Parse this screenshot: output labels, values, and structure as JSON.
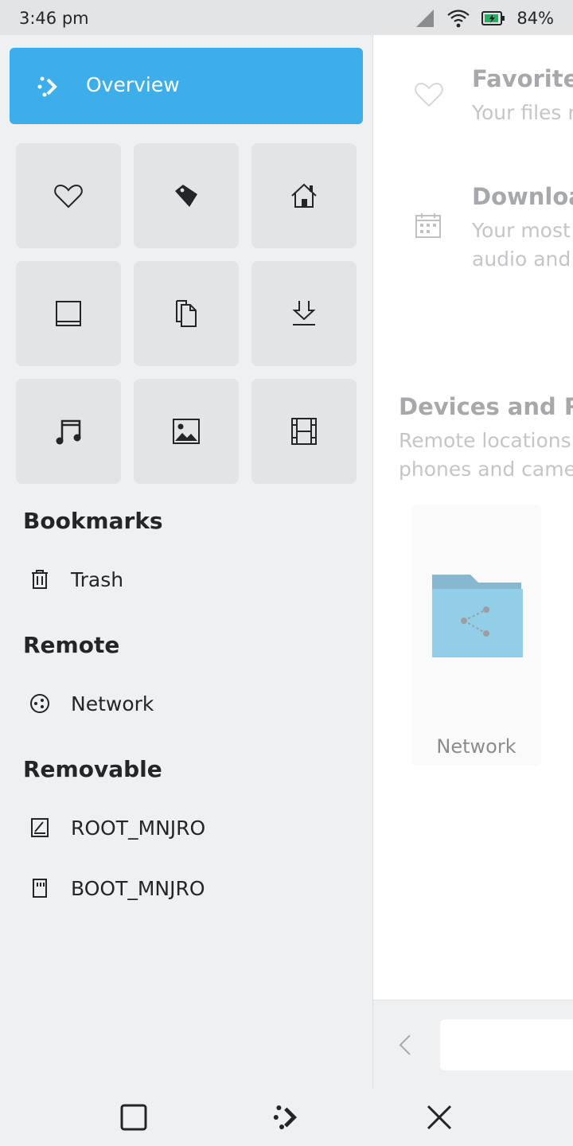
{
  "status": {
    "time": "3:46 pm",
    "battery": "84%"
  },
  "sidebar": {
    "overview_label": "Overview",
    "tiles": [
      "heart-icon",
      "tag-icon",
      "home-icon",
      "desktop-icon",
      "documents-icon",
      "download-icon",
      "music-icon",
      "pictures-icon",
      "video-icon"
    ],
    "sections": {
      "bookmarks": {
        "title": "Bookmarks",
        "items": [
          {
            "label": "Trash",
            "icon": "trash-icon"
          }
        ]
      },
      "remote": {
        "title": "Remote",
        "items": [
          {
            "label": "Network",
            "icon": "network-icon"
          }
        ]
      },
      "removable": {
        "title": "Removable",
        "items": [
          {
            "label": "ROOT_MNJRO",
            "icon": "drive-icon"
          },
          {
            "label": "BOOT_MNJRO",
            "icon": "sdcard-icon"
          }
        ]
      }
    }
  },
  "main": {
    "favorites": {
      "title": "Favorite",
      "subtitle": "Your files r"
    },
    "downloads": {
      "title": "Downloa",
      "subtitle_line1": "Your most",
      "subtitle_line2": "audio and"
    },
    "devices": {
      "title": "Devices and Re",
      "subtitle_line1": "Remote locations a",
      "subtitle_line2": "phones and camer"
    },
    "network_card_label": "Network"
  },
  "colors": {
    "accent": "#3daee9",
    "folder": "#93cee9"
  }
}
